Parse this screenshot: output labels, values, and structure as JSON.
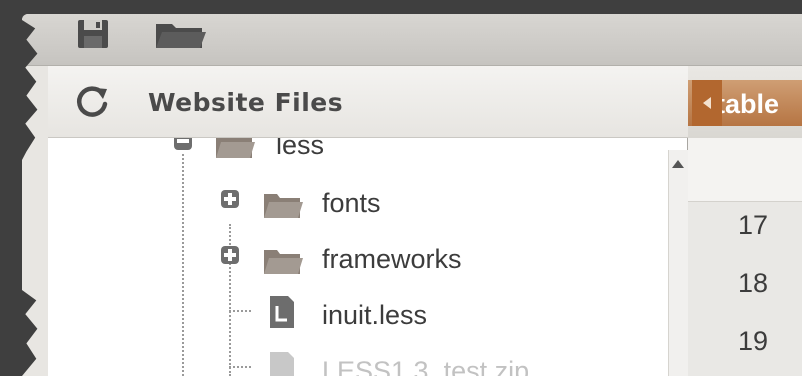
{
  "toolbar": {
    "save_icon": "save-icon",
    "open_icon": "folder-open-icon"
  },
  "panel": {
    "title": "Website Files",
    "refresh_icon": "refresh-icon"
  },
  "tree": {
    "items": [
      {
        "label": "less",
        "type": "folder",
        "expanded": true,
        "icon": "folder-icon"
      },
      {
        "label": "fonts",
        "type": "folder",
        "expanded": false,
        "icon": "folder-icon"
      },
      {
        "label": "frameworks",
        "type": "folder",
        "expanded": false,
        "icon": "folder-icon"
      },
      {
        "label": "inuit.less",
        "type": "file",
        "icon": "file-icon"
      },
      {
        "label": "LESS1.3_test.zip",
        "type": "file",
        "icon": "file-icon",
        "faded": true
      }
    ]
  },
  "editor": {
    "tab_label": "table",
    "line_numbers": [
      "17",
      "18",
      "19"
    ]
  },
  "colors": {
    "tab_accent": "#b67543",
    "background": "#3f3f3f",
    "panel": "#ffffff"
  }
}
